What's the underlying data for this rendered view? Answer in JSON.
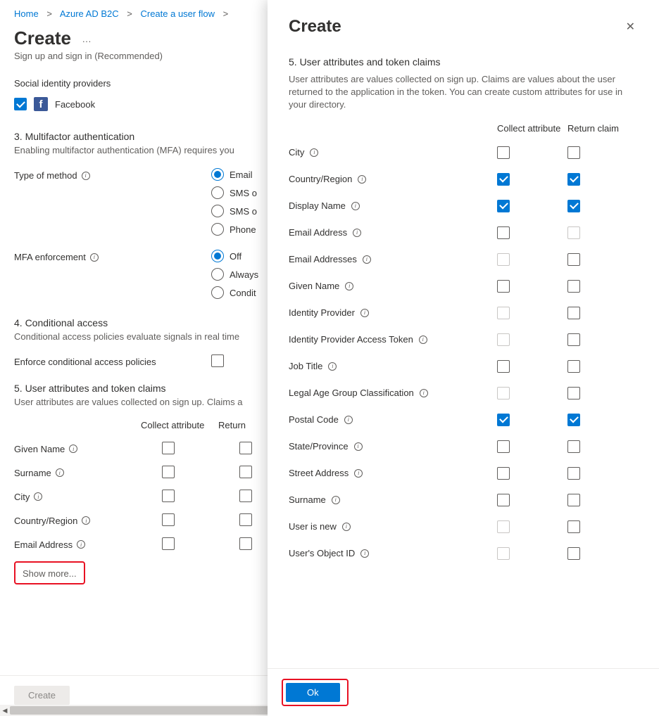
{
  "breadcrumb": [
    "Home",
    "Azure AD B2C",
    "Create a user flow"
  ],
  "page_title": "Create",
  "page_subtitle": "Sign up and sign in (Recommended)",
  "social_providers": {
    "label": "Social identity providers",
    "items": [
      {
        "name": "Facebook",
        "checked": true
      }
    ]
  },
  "left": {
    "mfa": {
      "heading": "3. Multifactor authentication",
      "desc": "Enabling multifactor authentication (MFA) requires you",
      "type_label": "Type of method",
      "type_options": [
        "Email",
        "SMS o",
        "SMS o",
        "Phone"
      ],
      "type_selected": 0,
      "enforce_label": "MFA enforcement",
      "enforce_options": [
        "Off",
        "Always",
        "Condit"
      ],
      "enforce_selected": 0
    },
    "cond": {
      "heading": "4. Conditional access",
      "desc": "Conditional access policies evaluate signals in real time",
      "checkbox_label": "Enforce conditional access policies",
      "checked": false
    },
    "attrs": {
      "heading": "5. User attributes and token claims",
      "desc": "User attributes are values collected on sign up. Claims a",
      "col1": "Collect attribute",
      "col2": "Return ",
      "rows": [
        {
          "name": "Given Name",
          "collect": false,
          "return": false
        },
        {
          "name": "Surname",
          "collect": false,
          "return": false
        },
        {
          "name": "City",
          "collect": false,
          "return": false
        },
        {
          "name": "Country/Region",
          "collect": false,
          "return": false
        },
        {
          "name": "Email Address",
          "collect": false,
          "return": false
        }
      ],
      "show_more": "Show more..."
    },
    "create_btn": "Create"
  },
  "right": {
    "title": "Create",
    "section_title": "5. User attributes and token claims",
    "desc": "User attributes are values collected on sign up. Claims are values about the user returned to the application in the token. You can create custom attributes for use in your directory.",
    "col1": "Collect attribute",
    "col2": "Return claim",
    "rows": [
      {
        "name": "City",
        "collect": false,
        "return": false,
        "collect_disabled": false,
        "return_disabled": false
      },
      {
        "name": "Country/Region",
        "collect": true,
        "return": true,
        "collect_disabled": false,
        "return_disabled": false
      },
      {
        "name": "Display Name",
        "collect": true,
        "return": true,
        "collect_disabled": false,
        "return_disabled": false
      },
      {
        "name": "Email Address",
        "collect": false,
        "return": false,
        "collect_disabled": false,
        "return_disabled": true
      },
      {
        "name": "Email Addresses",
        "collect": false,
        "return": false,
        "collect_disabled": true,
        "return_disabled": false
      },
      {
        "name": "Given Name",
        "collect": false,
        "return": false,
        "collect_disabled": false,
        "return_disabled": false
      },
      {
        "name": "Identity Provider",
        "collect": false,
        "return": false,
        "collect_disabled": true,
        "return_disabled": false
      },
      {
        "name": "Identity Provider Access Token",
        "collect": false,
        "return": false,
        "collect_disabled": true,
        "return_disabled": false
      },
      {
        "name": "Job Title",
        "collect": false,
        "return": false,
        "collect_disabled": false,
        "return_disabled": false
      },
      {
        "name": "Legal Age Group Classification",
        "collect": false,
        "return": false,
        "collect_disabled": true,
        "return_disabled": false
      },
      {
        "name": "Postal Code",
        "collect": true,
        "return": true,
        "collect_disabled": false,
        "return_disabled": false
      },
      {
        "name": "State/Province",
        "collect": false,
        "return": false,
        "collect_disabled": false,
        "return_disabled": false
      },
      {
        "name": "Street Address",
        "collect": false,
        "return": false,
        "collect_disabled": false,
        "return_disabled": false
      },
      {
        "name": "Surname",
        "collect": false,
        "return": false,
        "collect_disabled": false,
        "return_disabled": false
      },
      {
        "name": "User is new",
        "collect": false,
        "return": false,
        "collect_disabled": true,
        "return_disabled": false
      },
      {
        "name": "User's Object ID",
        "collect": false,
        "return": false,
        "collect_disabled": true,
        "return_disabled": false
      }
    ],
    "ok_btn": "Ok"
  }
}
